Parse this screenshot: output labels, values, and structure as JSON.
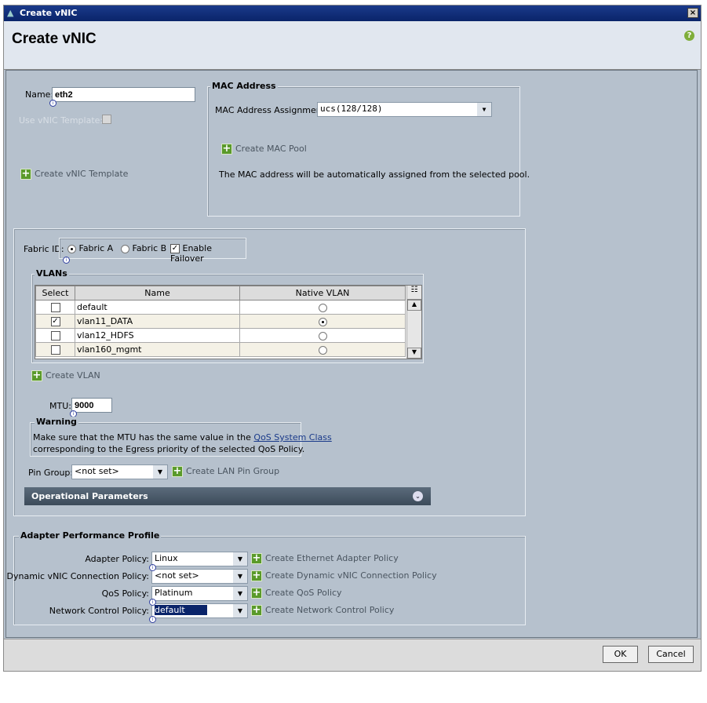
{
  "window": {
    "title": "Create vNIC",
    "close": "×"
  },
  "header": {
    "title": "Create vNIC",
    "help": "?"
  },
  "name": {
    "label": "Name:",
    "value": "eth2"
  },
  "use_template": {
    "label": "Use vNIC Template:"
  },
  "create_template": "Create vNIC Template",
  "mac": {
    "legend": "MAC Address",
    "assignment_label": "MAC Address Assignment:",
    "assignment_value": "ucs(128/128)",
    "create_pool": "Create MAC Pool",
    "note": "The MAC address will be automatically assigned from the selected pool."
  },
  "fabric": {
    "label": "Fabric ID:",
    "option_a": "Fabric A",
    "option_b": "Fabric B",
    "failover": "Enable Failover"
  },
  "vlans": {
    "legend": "VLANs",
    "columns": [
      "Select",
      "Name",
      "Native VLAN"
    ],
    "rows": [
      {
        "name": "default",
        "selected": false,
        "native": false
      },
      {
        "name": "vlan11_DATA",
        "selected": true,
        "native": true
      },
      {
        "name": "vlan12_HDFS",
        "selected": false,
        "native": false
      },
      {
        "name": "vlan160_mgmt",
        "selected": false,
        "native": false
      }
    ],
    "create": "Create VLAN"
  },
  "mtu": {
    "label": "MTU:",
    "value": "9000"
  },
  "warning": {
    "legend": "Warning",
    "text1": "Make sure that the MTU has the same value in the ",
    "link": "QoS System Class",
    "text2": "corresponding to the Egress priority of the selected QoS Policy."
  },
  "pin_group": {
    "label": "Pin Group:",
    "value": "<not set>",
    "create": "Create LAN Pin Group"
  },
  "operational": {
    "label": "Operational Parameters"
  },
  "adapter": {
    "legend": "Adapter Performance Profile",
    "rows": [
      {
        "label": "Adapter Policy:",
        "value": "Linux",
        "create": "Create Ethernet Adapter Policy"
      },
      {
        "label": "Dynamic vNIC Connection Policy:",
        "value": "<not set>",
        "create": "Create Dynamic vNIC Connection Policy"
      },
      {
        "label": "QoS Policy:",
        "value": "Platinum",
        "create": "Create QoS Policy"
      },
      {
        "label": "Network Control Policy:",
        "value": "default",
        "create": "Create Network Control Policy"
      }
    ]
  },
  "buttons": {
    "ok": "OK",
    "cancel": "Cancel"
  }
}
